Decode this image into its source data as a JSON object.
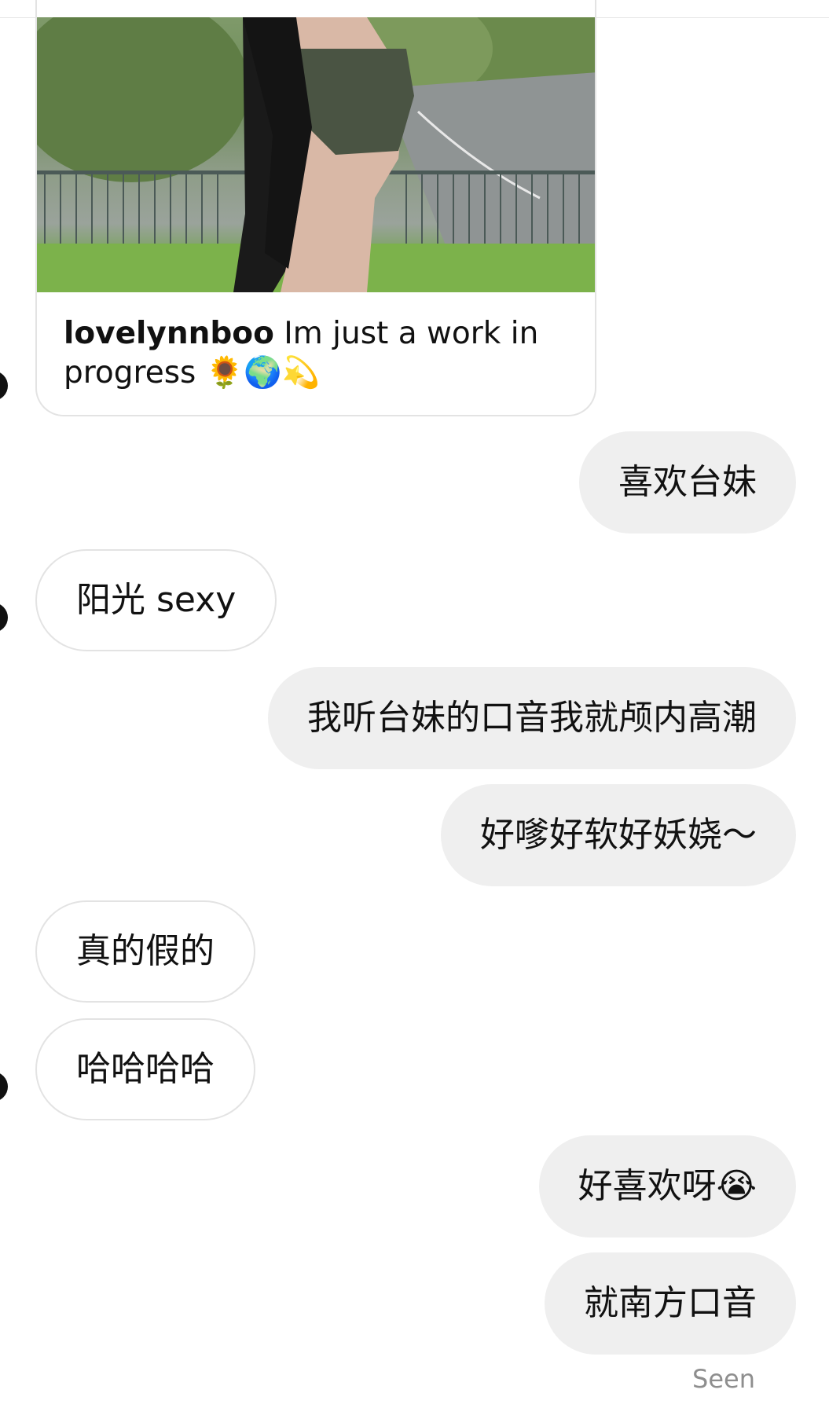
{
  "shared_post": {
    "username": "lovelynnboo",
    "caption": "Im just a work in progress",
    "caption_emojis": "🌻🌍💫"
  },
  "messages": [
    {
      "side": "out",
      "text": "喜欢台妹"
    },
    {
      "side": "in",
      "text": "阳光 sexy"
    },
    {
      "side": "out",
      "text": "我听台妹的口音我就颅内高潮"
    },
    {
      "side": "out",
      "text": "好嗲好软好妖娆～"
    },
    {
      "side": "in",
      "text": "真的假的"
    },
    {
      "side": "in",
      "text": "哈哈哈哈"
    },
    {
      "side": "out",
      "text": "好喜欢呀😭"
    },
    {
      "side": "out",
      "text": "就南方口音"
    }
  ],
  "status": {
    "seen_label": "Seen"
  },
  "colors": {
    "outgoing_bubble": "#efefef",
    "incoming_border": "#e3e3e3",
    "seen_text": "#8e8e8e"
  }
}
